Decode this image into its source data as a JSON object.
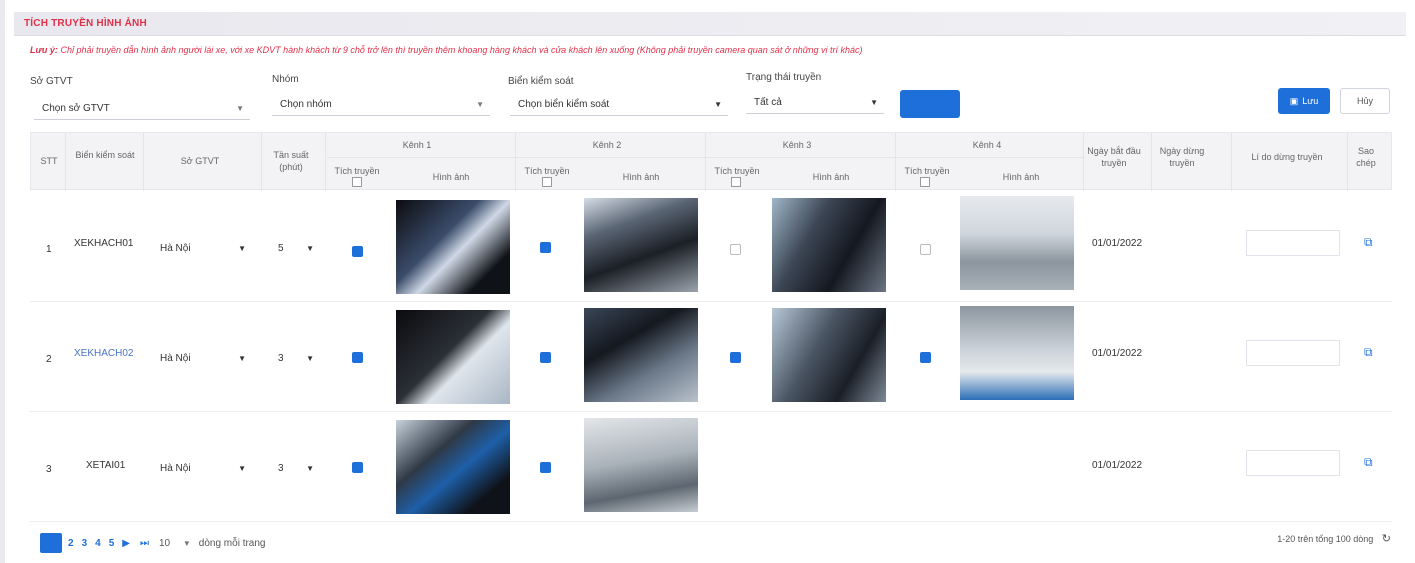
{
  "section_title": "TÍCH TRUYỀN HÌNH ẢNH",
  "note": {
    "lead": "Lưu ý:",
    "text": "Chỉ phải truyền dẫn hình ảnh người lái xe, với xe KDVT hành khách từ 9 chỗ trở lên thì truyền thêm khoang hàng khách và cửa khách lên xuống (Không phải truyền camera quan sát ở những vị trí khác)"
  },
  "filters": {
    "department": {
      "label": "Sở GTVT",
      "value": "Chọn sở GTVT"
    },
    "group": {
      "label": "Nhóm",
      "value": "Chọn nhóm"
    },
    "plate": {
      "label": "Biển kiểm soát",
      "value": "Chọn biển kiểm soát"
    },
    "status": {
      "label": "Trạng thái truyền",
      "value": "Tất cả"
    }
  },
  "actions": {
    "save_label": "Lưu",
    "cancel_label": "Hủy"
  },
  "table": {
    "headers": {
      "stt": "STT",
      "plate": "Biển kiểm soát",
      "department": "Sở GTVT",
      "frequency": "Tần suất (phút)",
      "channel1": "Kênh 1",
      "channel2": "Kênh 2",
      "channel3": "Kênh 3",
      "channel4": "Kênh 4",
      "transmit": "Tích truyền",
      "image": "Hình ảnh",
      "start_date": "Ngày bắt đầu truyền",
      "stop_date": "Ngày dừng truyền",
      "reason": "Lí do dừng truyền",
      "copy": "Sao chép"
    },
    "rows": [
      {
        "stt": "1",
        "plate": "XEKHACH01",
        "department": "Hà Nội",
        "frequency": "5",
        "start_date": "01/01/2022",
        "channels": [
          true,
          true,
          false,
          false
        ]
      },
      {
        "stt": "2",
        "plate": "XEKHACH02",
        "department": "Hà Nội",
        "frequency": "3",
        "start_date": "01/01/2022",
        "channels": [
          true,
          true,
          true,
          true
        ]
      },
      {
        "stt": "3",
        "plate": "XETAI01",
        "department": "Hà Nội",
        "frequency": "3",
        "start_date": "01/01/2022",
        "channels": [
          true,
          true
        ]
      }
    ]
  },
  "pagination": {
    "pages": [
      "2",
      "3",
      "4",
      "5"
    ],
    "page_size": "10",
    "page_size_label": "dòng mỗi trang",
    "summary": "1-20 trên tổng 100 dòng"
  },
  "colors": {
    "accent": "#1e6fd9",
    "title": "#e0314a"
  }
}
